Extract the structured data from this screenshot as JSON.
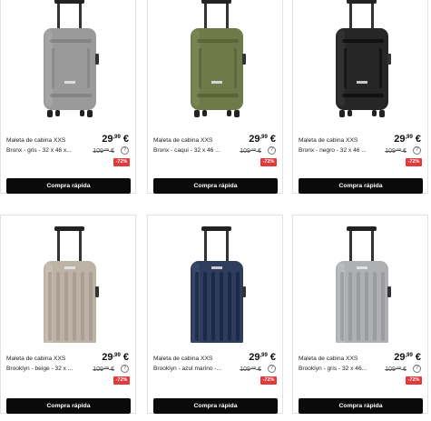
{
  "products": [
    {
      "name_line1": "Maleta de cabina XXS",
      "name_line2": "Bronx - gris - 32 x 46 x...",
      "price": "29,99 €",
      "old_price": "109,99 €",
      "discount": "-72%",
      "button": "Compra rápida",
      "color": "#9a9a9a",
      "icon": "suitcase-image"
    },
    {
      "name_line1": "Maleta de cabina XXS",
      "name_line2": "Bronx - caqui - 32 x 46 ...",
      "price": "29,99 €",
      "old_price": "109,99 €",
      "discount": "-72%",
      "button": "Compra rápida",
      "color": "#6f7a4a",
      "icon": "suitcase-image"
    },
    {
      "name_line1": "Maleta de cabina XXS",
      "name_line2": "Bronx - negro - 32 x 46 ...",
      "price": "29,99 €",
      "old_price": "109,99 €",
      "discount": "-72%",
      "button": "Compra rápida",
      "color": "#262626",
      "icon": "suitcase-image"
    },
    {
      "name_line1": "Maleta de cabina XXS",
      "name_line2": "Brooklyn - beige - 32 x ...",
      "price": "29,99 €",
      "old_price": "109,99 €",
      "discount": "-72%",
      "button": "Compra rápida",
      "color": "#bcb3a6",
      "icon": "suitcase-image"
    },
    {
      "name_line1": "Maleta de cabina XXS",
      "name_line2": "Brooklyn - azul marino -...",
      "price": "29,99 €",
      "old_price": "109,99 €",
      "discount": "-72%",
      "button": "Compra rápida",
      "color": "#2f3d5c",
      "icon": "suitcase-image"
    },
    {
      "name_line1": "Maleta de cabina XXS",
      "name_line2": "Brooklyn - gris - 32 x 46...",
      "price": "29,99 €",
      "old_price": "109,99 €",
      "discount": "-72%",
      "button": "Compra rápida",
      "color": "#aeb0b2",
      "icon": "suitcase-image"
    }
  ],
  "help_glyph": "?"
}
